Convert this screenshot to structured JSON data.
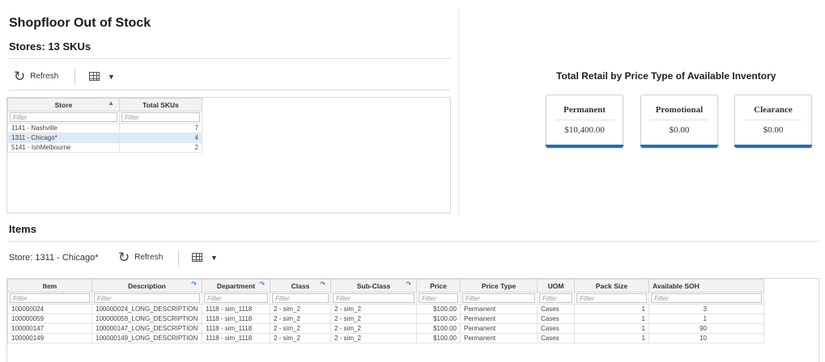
{
  "page_title": "Shopfloor Out of Stock",
  "stores": {
    "title": "Stores: 13 SKUs",
    "toolbar": {
      "refresh_label": "Refresh"
    },
    "columns": [
      "Store",
      "Total SKUs"
    ],
    "filter_placeholder": "Filter",
    "rows": [
      {
        "store": "1141 - Nashville",
        "skus": "7"
      },
      {
        "store": "1311 - Chicago*",
        "skus": "4"
      },
      {
        "store": "5141 - IshMelbourne",
        "skus": "2"
      }
    ]
  },
  "retail": {
    "title": "Total Retail by Price Type of Available Inventory",
    "cards": [
      {
        "label": "Permanent",
        "value": "$10,400.00"
      },
      {
        "label": "Promotional",
        "value": "$0.00"
      },
      {
        "label": "Clearance",
        "value": "$0.00"
      }
    ],
    "accent_color": "#1f6fbf"
  },
  "items": {
    "title": "Items",
    "store_label": "Store: 1311 - Chicago*",
    "toolbar": {
      "refresh_label": "Refresh"
    },
    "filter_placeholder": "Filter",
    "columns": [
      "Item",
      "Description",
      "Department",
      "Class",
      "Sub-Class",
      "Price",
      "Price Type",
      "UOM",
      "Pack Size",
      "Available SOH"
    ],
    "rows": [
      [
        "100000024",
        "100000024_LONG_DESCRIPTION",
        "1118 - sim_1118",
        "2 - sim_2",
        "2 - sim_2",
        "$100.00",
        "Permanent",
        "Cases",
        "1",
        "3"
      ],
      [
        "100000059",
        "100000059_LONG_DESCRIPTION",
        "1118 - sim_1118",
        "2 - sim_2",
        "2 - sim_2",
        "$100.00",
        "Permanent",
        "Cases",
        "1",
        "1"
      ],
      [
        "100000147",
        "100000147_LONG_DESCRIPTION",
        "1118 - sim_1118",
        "2 - sim_2",
        "2 - sim_2",
        "$100.00",
        "Permanent",
        "Cases",
        "1",
        "90"
      ],
      [
        "100000149",
        "100000149_LONG_DESCRIPTION",
        "1118 - sim_1118",
        "2 - sim_2",
        "2 - sim_2",
        "$100.00",
        "Permanent",
        "Cases",
        "1",
        "10"
      ]
    ]
  },
  "icons": [
    "refresh-icon",
    "grid-view-icon",
    "chevron-down-icon",
    "sort-ascending-icon",
    "sort-icon"
  ]
}
